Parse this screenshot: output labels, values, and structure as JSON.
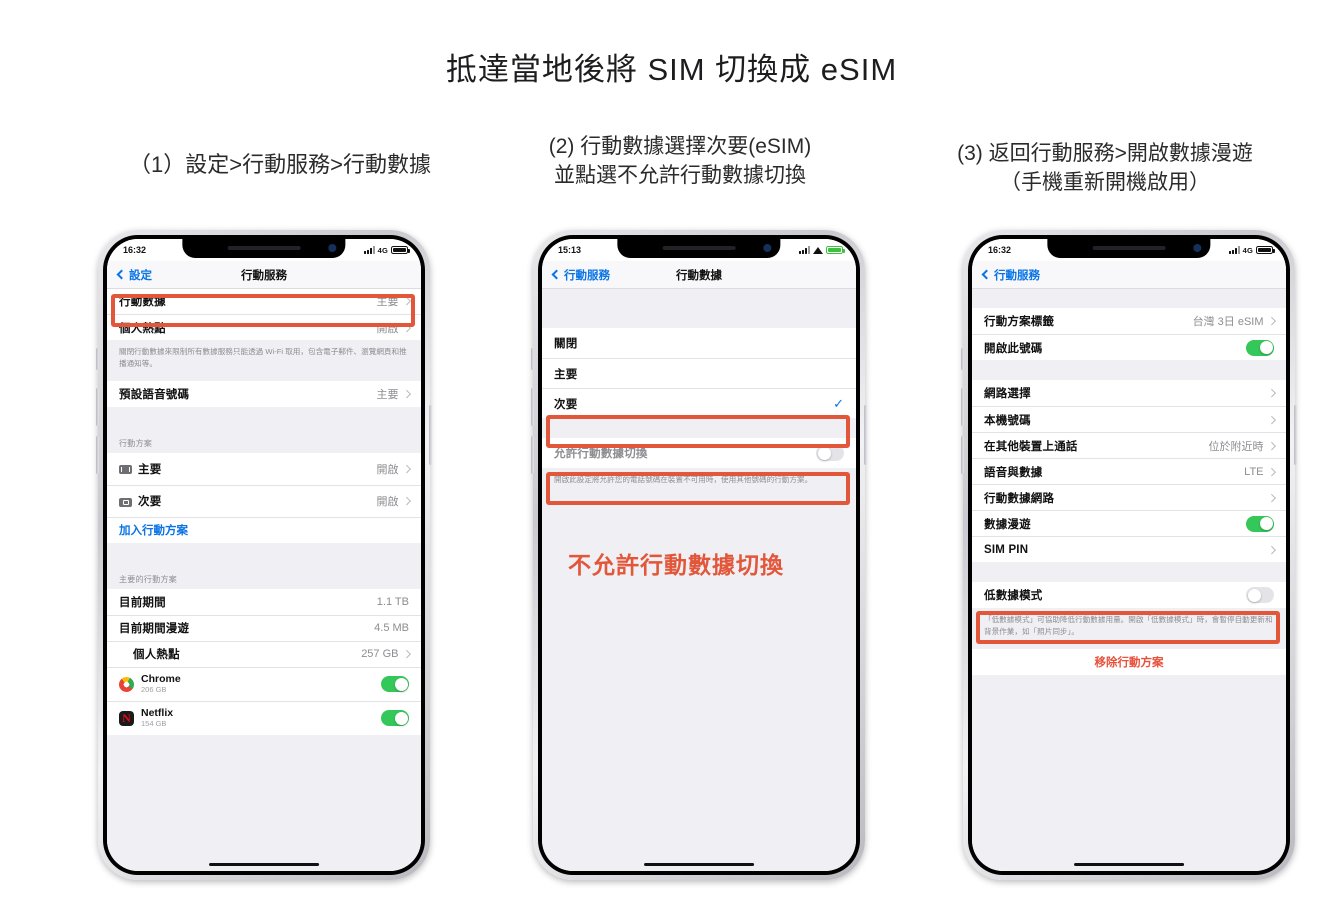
{
  "page": {
    "title": "抵達當地後將 SIM 切換成 eSIM",
    "accent_orange": "#e2563a",
    "accent_blue": "#0a74e6",
    "accent_green": "#34c759",
    "accent_red": "#e8513c"
  },
  "captions": {
    "one": {
      "line1": "（1）設定>行動服務>行動數據"
    },
    "two": {
      "line1": "(2) 行動數據選擇次要(eSIM)",
      "line2": "並點選不允許行動數據切換"
    },
    "three": {
      "line1": "(3) 返回行動服務>開啟數據漫遊",
      "line2": "（手機重新開機啟用）"
    }
  },
  "phone1": {
    "status": {
      "time": "16:32",
      "network": "4G"
    },
    "nav": {
      "back": "設定",
      "title": "行動服務"
    },
    "rows": {
      "cellular_data": {
        "label": "行動數據",
        "value": "主要"
      },
      "personal_hotspot": {
        "label": "個人熱點",
        "value": "開啟"
      },
      "footer1": "關閉行動數據來限制所有數據服務只能透過 Wi-Fi 取用，包含電子郵件、瀏覽網頁和推播通知等。",
      "default_voice": {
        "label": "預設語音號碼",
        "value": "主要"
      },
      "plans_header": "行動方案",
      "plan_primary": {
        "label": "主要",
        "value": "開啟"
      },
      "plan_secondary": {
        "label": "次要",
        "value": "開啟"
      },
      "add_plan": "加入行動方案",
      "usage_header": "主要的行動方案",
      "current_period": {
        "label": "目前期間",
        "value": "1.1 TB"
      },
      "current_period_roaming": {
        "label": "目前期間漫遊",
        "value": "4.5 MB"
      },
      "hotspot_usage": {
        "label": "個人熱點",
        "value": "257 GB"
      },
      "app_chrome": {
        "name": "Chrome",
        "size": "206 GB"
      },
      "app_netflix": {
        "name": "Netflix",
        "size": "154 GB"
      }
    }
  },
  "phone2": {
    "status": {
      "time": "15:13"
    },
    "nav": {
      "back": "行動服務",
      "title": "行動數據"
    },
    "rows": {
      "off": {
        "label": "關閉"
      },
      "primary": {
        "label": "主要"
      },
      "secondary": {
        "label": "次要",
        "check": "✓"
      },
      "allow_switch": {
        "label": "允許行動數據切換"
      },
      "footer": "開啟此設定將允許您的電話號碼在裝置不可用時，使用其他號碼的行動方案。"
    },
    "overlay_text": "不允許行動數據切換"
  },
  "phone3": {
    "status": {
      "time": "16:32",
      "network": "4G"
    },
    "nav": {
      "back": "行動服務",
      "title": ""
    },
    "rows": {
      "plan_label": {
        "label": "行動方案標籤",
        "value": "台灣 3日 eSIM"
      },
      "enable_line": {
        "label": "開啟此號碼"
      },
      "network_select": {
        "label": "網路選擇"
      },
      "my_number": {
        "label": "本機號碼"
      },
      "calls_other": {
        "label": "在其他裝置上通話",
        "value": "位於附近時"
      },
      "voice_data": {
        "label": "語音與數據",
        "value": "LTE"
      },
      "cellular_network": {
        "label": "行動數據網路"
      },
      "data_roaming": {
        "label": "數據漫遊"
      },
      "sim_pin": {
        "label": "SIM PIN"
      },
      "low_data": {
        "label": "低數據模式"
      },
      "footer": "「低數據模式」可協助降低行動數據用量。開啟「低數據模式」時，會暫停自動更新和背景作業，如「照片同步」。",
      "remove_plan": "移除行動方案"
    }
  }
}
